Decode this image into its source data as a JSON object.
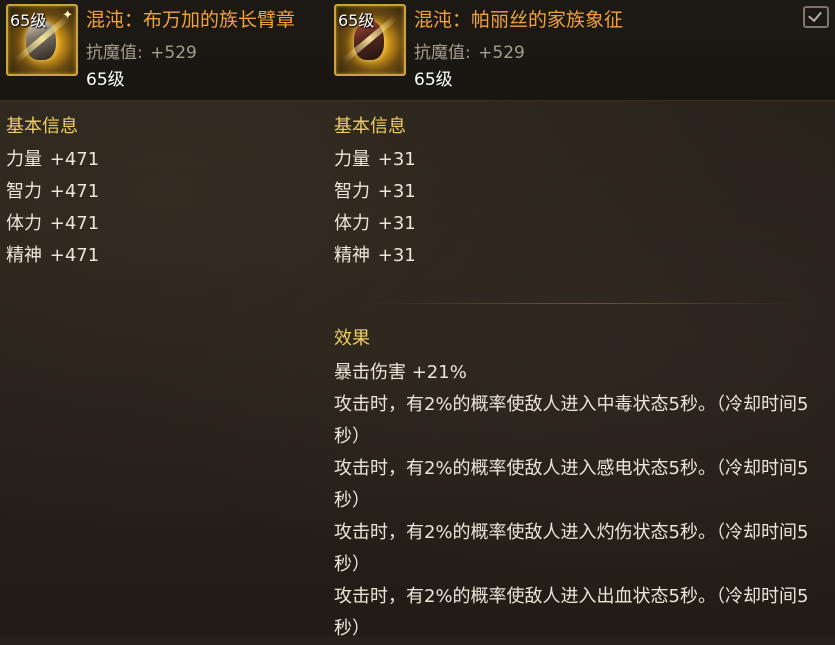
{
  "left_item": {
    "icon_name": "wrist-guard-icon",
    "icon_level": "65级",
    "name": "混沌：布万加的族长臂章",
    "resist_label": "抗魔值:",
    "resist_value": "+529",
    "level": "65级",
    "section_basic": "基本信息",
    "stats": [
      {
        "label": "力量",
        "value": "+471"
      },
      {
        "label": "智力",
        "value": "+471"
      },
      {
        "label": "体力",
        "value": "+471"
      },
      {
        "label": "精神",
        "value": "+471"
      }
    ]
  },
  "right_item": {
    "icon_name": "family-emblem-icon",
    "icon_level": "65级",
    "name": "混沌：帕丽丝的家族象征",
    "resist_label": "抗魔值:",
    "resist_value": "+529",
    "level": "65级",
    "section_basic": "基本信息",
    "stats": [
      {
        "label": "力量",
        "value": "+31"
      },
      {
        "label": "智力",
        "value": "+31"
      },
      {
        "label": "体力",
        "value": "+31"
      },
      {
        "label": "精神",
        "value": "+31"
      }
    ],
    "section_effect": "效果",
    "effects": [
      "暴击伤害 +21%",
      "攻击时，有2%的概率使敌人进入中毒状态5秒。（冷却时间5秒）",
      "攻击时，有2%的概率使敌人进入感电状态5秒。（冷却时间5秒）",
      "攻击时，有2%的概率使敌人进入灼伤状态5秒。（冷却时间5秒）",
      "攻击时，有2%的概率使敌人进入出血状态5秒。（冷却时间5秒）"
    ]
  },
  "colors": {
    "item_name": "#f2a236",
    "section_title": "#f0cd62",
    "resist": "#a49c90",
    "text": "#ece6da"
  }
}
